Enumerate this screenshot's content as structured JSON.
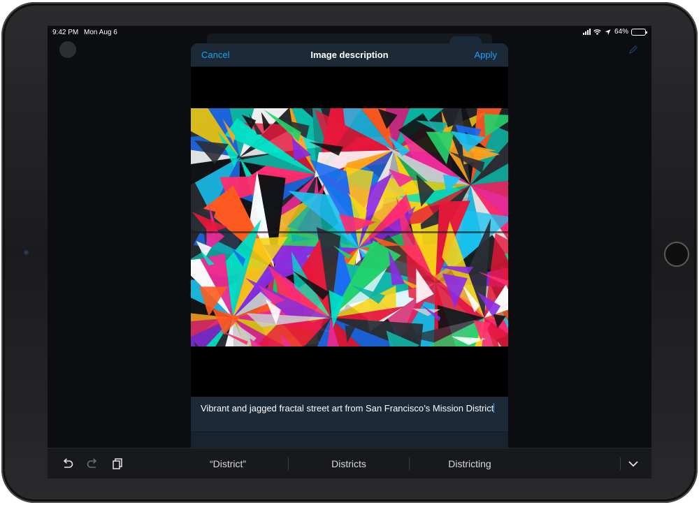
{
  "status_bar": {
    "time": "9:42 PM",
    "date": "Mon Aug 6",
    "battery": "64%",
    "battery_level": 0.64,
    "icons": [
      "signal-icon",
      "wifi-icon",
      "location-icon",
      "battery-icon"
    ]
  },
  "dialog": {
    "title": "Image description",
    "cancel_label": "Cancel",
    "apply_label": "Apply",
    "description_text": "Vibrant and jagged fractal street art from San Francisco’s Mission District"
  },
  "keyboard_bar": {
    "suggestions": [
      "“District”",
      "Districts",
      "Districting"
    ],
    "icons": [
      "undo-icon",
      "redo-icon",
      "paste-icon",
      "dismiss-keyboard-icon"
    ]
  },
  "colors": {
    "accent": "#1da1f2",
    "modal_background": "#15202b",
    "header_background": "#1c2a38",
    "screen_background": "#0b0d10"
  }
}
